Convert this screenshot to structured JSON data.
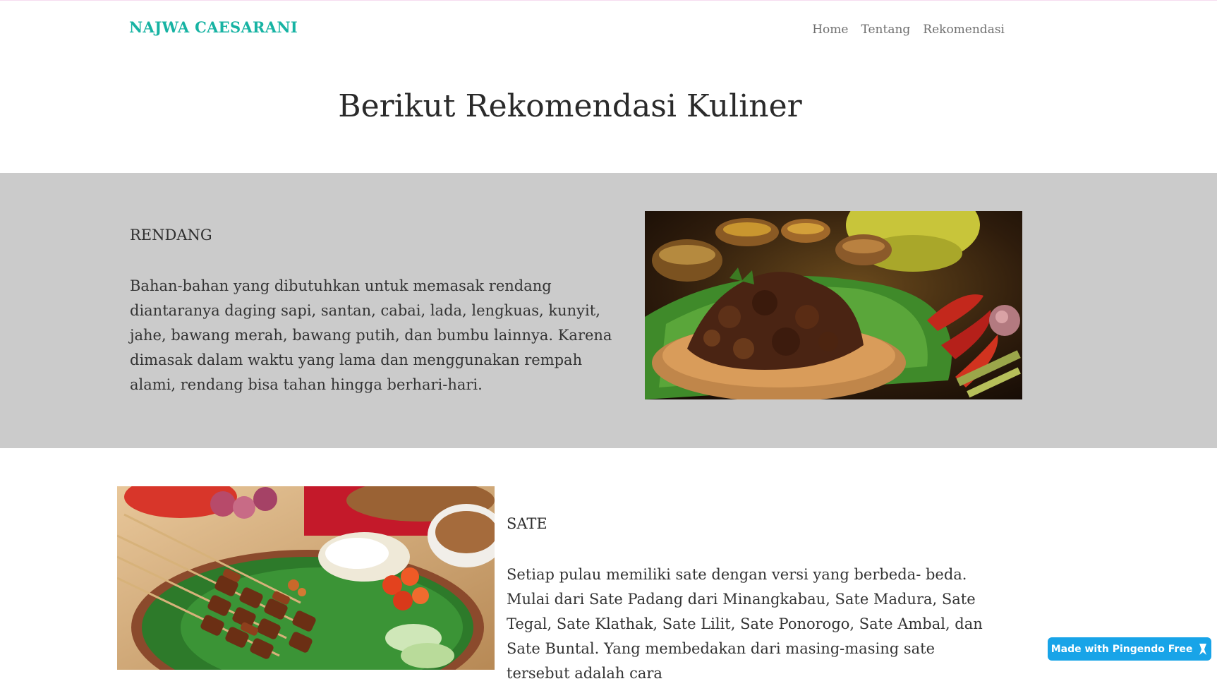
{
  "navbar": {
    "brand": "NAJWA CAESARANI",
    "links": [
      "Home",
      "Tentang",
      "Rekomendasi"
    ]
  },
  "page": {
    "heading": "Berikut Rekomendasi Kuliner"
  },
  "items": [
    {
      "title": "RENDANG",
      "text": "Bahan-bahan yang dibutuhkan untuk memasak rendang diantaranya daging sapi, santan, cabai, lada, lengkuas, kunyit, jahe, bawang merah, bawang putih, dan bumbu lainnya. Karena dimasak dalam waktu yang lama dan menggunakan rempah alami, rendang bisa tahan hingga berhari-hari."
    },
    {
      "title": "SATE",
      "text": "Setiap pulau memiliki sate dengan versi yang berbeda- beda. Mulai dari Sate Padang dari Minangkabau, Sate Madura, Sate Tegal, Sate Klathak, Sate Lilit, Sate Ponorogo, Sate Ambal, dan Sate Buntal. Yang membedakan dari masing-masing sate tersebut adalah cara"
    }
  ],
  "badge": {
    "label": "Made with Pingendo Free",
    "icon": "pingendo-logo-icon"
  }
}
